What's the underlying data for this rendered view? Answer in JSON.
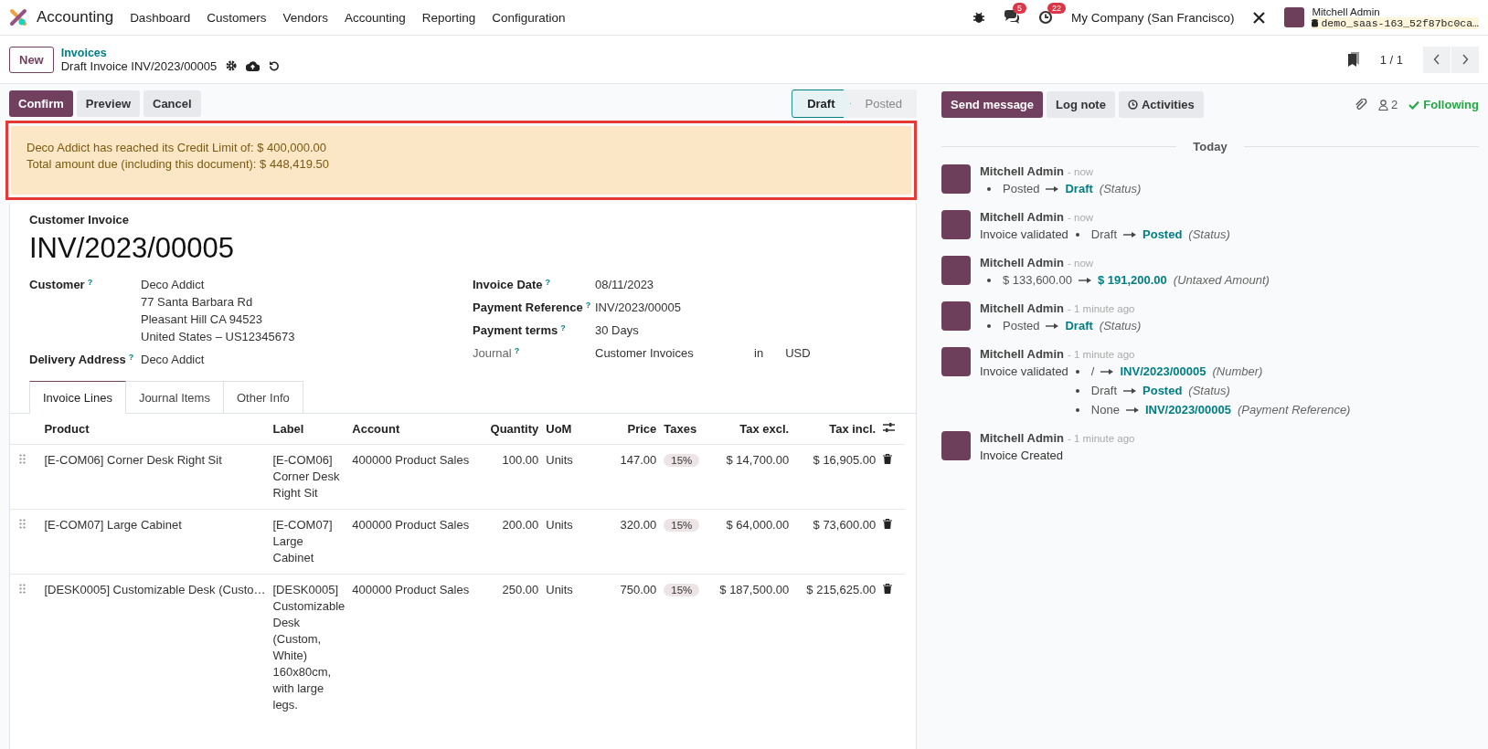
{
  "navbar": {
    "app_name": "Accounting",
    "menu": [
      "Dashboard",
      "Customers",
      "Vendors",
      "Accounting",
      "Reporting",
      "Configuration"
    ],
    "messages_count": "5",
    "activities_count": "22",
    "company": "My Company (San Francisco)",
    "user_name": "Mitchell Admin",
    "database": "demo_saas-163_52f87bc0ca…"
  },
  "control_panel": {
    "new_button": "New",
    "breadcrumb_parent": "Invoices",
    "breadcrumb_current": "Draft Invoice INV/2023/00005",
    "pager": "1 / 1"
  },
  "actions": [
    {
      "label": "Confirm",
      "kind": "primary"
    },
    {
      "label": "Preview",
      "kind": "secondary"
    },
    {
      "label": "Cancel",
      "kind": "secondary"
    }
  ],
  "status_steps": [
    {
      "label": "Draft",
      "selected": true
    },
    {
      "label": "Posted",
      "selected": false
    }
  ],
  "alert": {
    "highlighted": true,
    "lines": [
      "Deco Addict has reached its Credit Limit of: $ 400,000.00",
      "Total amount due (including this document): $ 448,419.50"
    ]
  },
  "form": {
    "type_label": "Customer Invoice",
    "number": "INV/2023/00005",
    "left_fields": [
      {
        "label": "Customer",
        "help": "?",
        "lines": [
          "Deco Addict",
          "77 Santa Barbara Rd",
          "Pleasant Hill CA 94523",
          "United States – US12345673"
        ],
        "muted": false
      },
      {
        "label": "Delivery Address",
        "help": "?",
        "lines": [
          "Deco Addict"
        ],
        "muted": false
      }
    ],
    "right_fields": [
      {
        "label": "Invoice Date",
        "help": "?",
        "lines": [
          "08/11/2023"
        ],
        "muted": false
      },
      {
        "label": "Payment Reference",
        "help": "?",
        "lines": [
          "INV/2023/00005"
        ],
        "muted": false
      },
      {
        "label": "Payment terms",
        "help": "?",
        "lines": [
          "30 Days"
        ],
        "muted": false
      },
      {
        "label": "Journal",
        "help": "?",
        "lines": [
          "Customer Invoices"
        ],
        "muted": true,
        "suffix_word": "in",
        "currency": "USD"
      }
    ]
  },
  "tabs": [
    {
      "label": "Invoice Lines",
      "selected": true
    },
    {
      "label": "Journal Items",
      "selected": false
    },
    {
      "label": "Other Info",
      "selected": false
    }
  ],
  "table": {
    "columns": [
      "Product",
      "Label",
      "Account",
      "Quantity",
      "UoM",
      "Price",
      "Taxes",
      "Tax excl.",
      "Tax incl."
    ],
    "rows": [
      {
        "product": "[E-COM06] Corner Desk Right Sit",
        "label": [
          "[E-COM06]",
          "Corner Desk",
          "Right Sit"
        ],
        "account": "400000 Product Sales",
        "quantity": "100.00",
        "uom": "Units",
        "price": "147.00",
        "tax": "15%",
        "tax_excl": "$ 14,700.00",
        "tax_incl": "$ 16,905.00"
      },
      {
        "product": "[E-COM07] Large Cabinet",
        "label": [
          "[E-COM07]",
          "Large",
          "Cabinet"
        ],
        "account": "400000 Product Sales",
        "quantity": "200.00",
        "uom": "Units",
        "price": "320.00",
        "tax": "15%",
        "tax_excl": "$ 64,000.00",
        "tax_incl": "$ 73,600.00"
      },
      {
        "product": "[DESK0005] Customizable Desk (Custo…",
        "label": [
          "[DESK0005]",
          "Customizable",
          "Desk",
          "(Custom,",
          "White)",
          "160x80cm,",
          "with large",
          "legs."
        ],
        "account": "400000 Product Sales",
        "quantity": "250.00",
        "uom": "Units",
        "price": "750.00",
        "tax": "15%",
        "tax_excl": "$ 187,500.00",
        "tax_incl": "$ 215,625.00"
      }
    ]
  },
  "chatter": {
    "buttons": [
      {
        "label": "Send message",
        "kind": "primary"
      },
      {
        "label": "Log note",
        "kind": "secondary"
      },
      {
        "label": "Activities",
        "kind": "activities"
      }
    ],
    "followers": "2",
    "following": "Following",
    "date_label": "Today",
    "messages": [
      {
        "author": "Mitchell Admin",
        "time": "- now",
        "changes": [
          {
            "old": "Posted",
            "new": "Draft",
            "field": "(Status)"
          }
        ]
      },
      {
        "author": "Mitchell Admin",
        "time": "- now",
        "intro": "Invoice validated",
        "changes": [
          {
            "old": "Draft",
            "new": "Posted",
            "field": "(Status)"
          }
        ]
      },
      {
        "author": "Mitchell Admin",
        "time": "- now",
        "changes": [
          {
            "old": "$ 133,600.00",
            "new": "$ 191,200.00",
            "field": "(Untaxed Amount)"
          }
        ]
      },
      {
        "author": "Mitchell Admin",
        "time": "- 1 minute ago",
        "changes": [
          {
            "old": "Posted",
            "new": "Draft",
            "field": "(Status)"
          }
        ]
      },
      {
        "author": "Mitchell Admin",
        "time": "- 1 minute ago",
        "intro": "Invoice validated",
        "changes": [
          {
            "old": "/",
            "new": "INV/2023/00005",
            "field": "(Number)"
          },
          {
            "old": "Draft",
            "new": "Posted",
            "field": "(Status)"
          },
          {
            "old": "None",
            "new": "INV/2023/00005",
            "field": "(Payment Reference)"
          }
        ]
      },
      {
        "author": "Mitchell Admin",
        "time": "- 1 minute ago",
        "body": "Invoice Created"
      }
    ]
  }
}
